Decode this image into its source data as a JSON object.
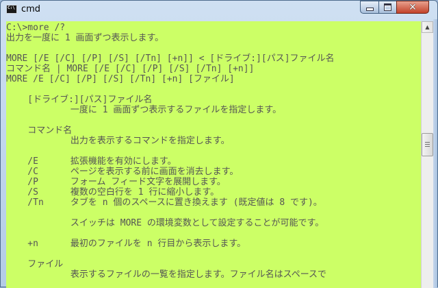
{
  "window": {
    "title": "cmd",
    "app_icon_text": "C:\\",
    "controls": {
      "minimize_icon": "minimize-icon",
      "maximize_icon": "maximize-icon",
      "close_icon": "close-icon",
      "close_glyph": "✕"
    }
  },
  "console": {
    "background_color": "#ccff66",
    "text_color": "#555555",
    "lines": [
      "C:\\>more /?",
      "出力を一度に 1 画面ずつ表示します。",
      "",
      "MORE [/E [/C] [/P] [/S] [/Tn] [+n]] < [ドライブ:][パス]ファイル名",
      "コマンド名 | MORE [/E [/C] [/P] [/S] [/Tn] [+n]]",
      "MORE /E [/C] [/P] [/S] [/Tn] [+n] [ファイル]",
      "",
      "    [ドライブ:][パス]ファイル名",
      "            一度に 1 画面ずつ表示するファイルを指定します。",
      "",
      "    コマンド名",
      "            出力を表示するコマンドを指定します。",
      "",
      "    /E      拡張機能を有効にします。",
      "    /C      ページを表示する前に画面を消去します。",
      "    /P      フォーム フィード文字を展開します。",
      "    /S      複数の空白行を 1 行に縮小します。",
      "    /Tn     タブを n 個のスペースに置き換えます (既定値は 8 です)。",
      "",
      "            スイッチは MORE の環境変数として設定することが可能です。",
      "",
      "    +n      最初のファイルを n 行目から表示します。",
      "",
      "    ファイル",
      "            表示するファイルの一覧を指定します。ファイル名はスペースで"
    ]
  },
  "scrollbar": {
    "up_glyph": "▲",
    "up_icon": "scroll-up-arrow-icon"
  }
}
